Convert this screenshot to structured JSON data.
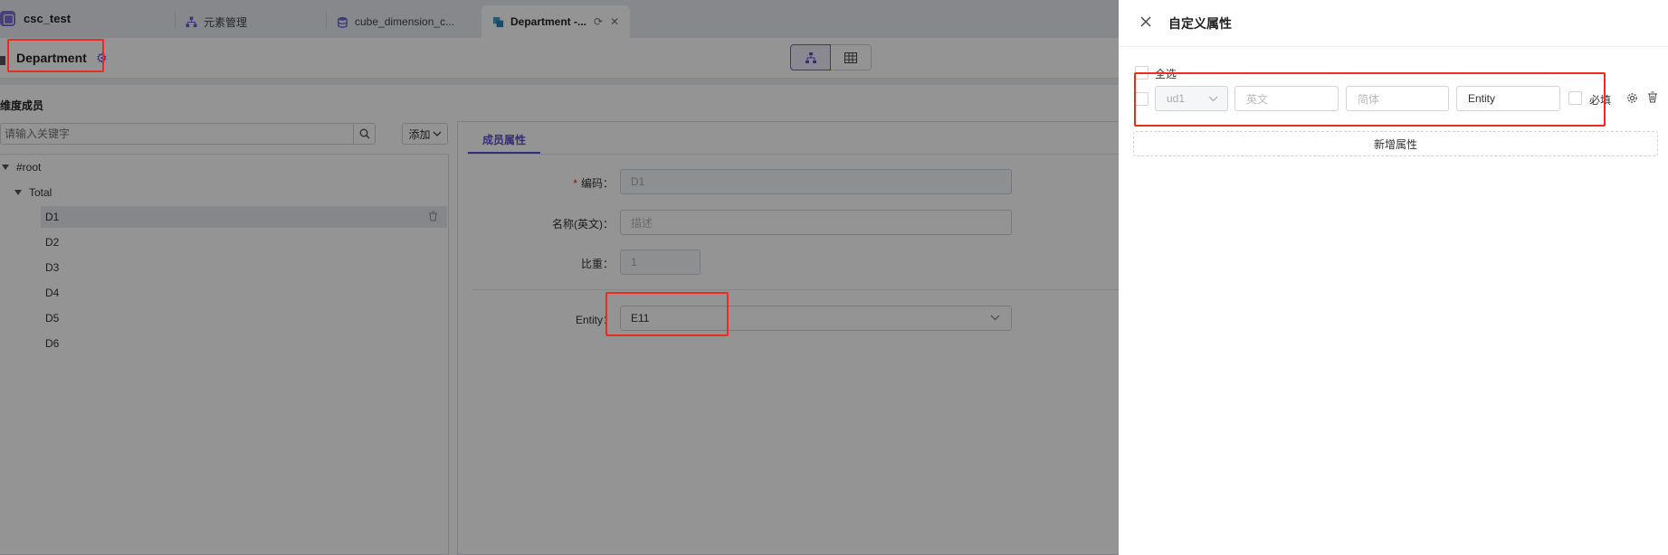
{
  "app": {
    "name": "csc_test"
  },
  "tabs": [
    {
      "label": "元素管理",
      "icon": "hierarchy-icon"
    },
    {
      "label": "cube_dimension_c...",
      "icon": "database-icon"
    },
    {
      "label": "Department -...",
      "icon": "dimension-icon"
    }
  ],
  "header": {
    "title": "Department"
  },
  "sidebar": {
    "members_label": "维度成员",
    "search_placeholder": "请输入关键字",
    "add_label": "添加",
    "tree": [
      {
        "label": "#root",
        "expanded": true
      },
      {
        "label": "Total",
        "expanded": true
      },
      {
        "label": "D1",
        "selected": true
      },
      {
        "label": "D2"
      },
      {
        "label": "D3"
      },
      {
        "label": "D4"
      },
      {
        "label": "D5"
      },
      {
        "label": "D6"
      }
    ]
  },
  "detail": {
    "tab_label": "成员属性",
    "fields": {
      "code": {
        "label": "编码",
        "value": "D1"
      },
      "name_en": {
        "label": "名称(英文)",
        "placeholder": "描述"
      },
      "weight": {
        "label": "比重",
        "value": "1"
      },
      "entity": {
        "label": "Entity",
        "value": "E11"
      }
    }
  },
  "drawer": {
    "title": "自定义属性",
    "select_all_label": "全选",
    "row": {
      "code": "ud1",
      "en_placeholder": "英文",
      "cn_placeholder": "简体",
      "type_value": "Entity",
      "required_label": "必填"
    },
    "add_property_label": "新增属性"
  },
  "colors": {
    "accent": "#5a4fcf",
    "highlight": "#ee2a22"
  }
}
